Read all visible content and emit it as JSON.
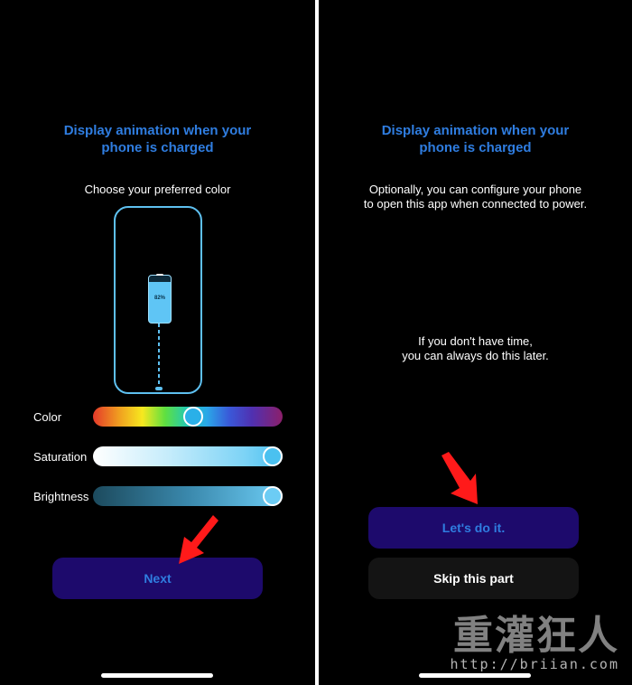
{
  "left": {
    "title": "Display animation when your\nphone is charged",
    "subtitle": "Choose your preferred color",
    "preview": {
      "battery_percent": "82%"
    },
    "sliders": [
      {
        "label": "Color",
        "value_percent": 53
      },
      {
        "label": "Saturation",
        "value_percent": 100
      },
      {
        "label": "Brightness",
        "value_percent": 100
      }
    ],
    "next_label": "Next"
  },
  "right": {
    "title": "Display animation when your\nphone is charged",
    "text1": "Optionally, you can configure your phone\nto open this app when connected to power.",
    "text2": "If you don't have time,\nyou can always do this later.",
    "primary_label": "Let's do it.",
    "secondary_label": "Skip this part"
  },
  "watermark": {
    "cn": "重灌狂人",
    "url": "http://briian.com"
  },
  "colors": {
    "accent": "#2f7de0",
    "primary_button_bg": "#1d0a6c",
    "arrow": "#ff1a1a",
    "preview_outline": "#5ec0f0"
  },
  "icons": {
    "annotation_arrow": "red-arrow-icon"
  }
}
